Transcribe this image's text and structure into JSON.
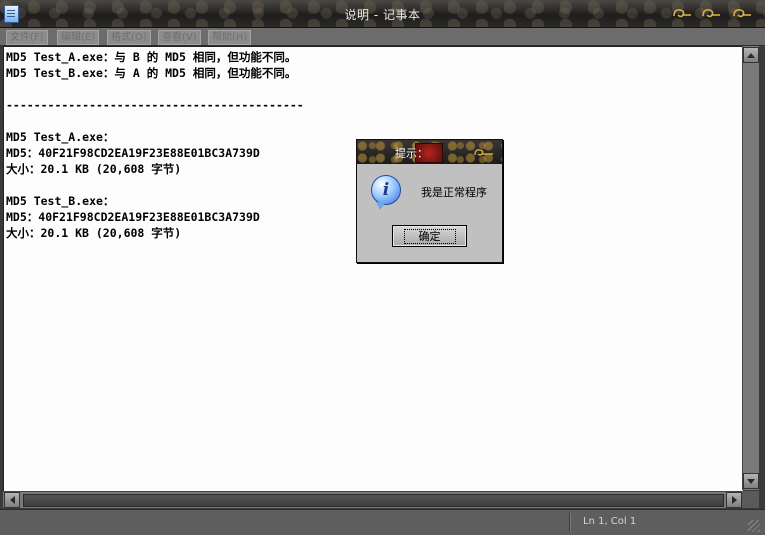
{
  "window": {
    "title": "说明 - 记事本",
    "icon": "notepad-icon",
    "buttons": [
      "minimize-icon",
      "maximize-icon",
      "close-icon"
    ],
    "accent": "#d8b04a"
  },
  "menu": {
    "items": [
      {
        "label": "文件(F)"
      },
      {
        "label": "编辑(E)"
      },
      {
        "label": "格式(O)"
      },
      {
        "label": "查看(V)"
      },
      {
        "label": "帮助(H)"
      }
    ]
  },
  "editor": {
    "lines": [
      "MD5 Test_A.exe：与 B 的 MD5 相同，但功能不同。",
      "MD5 Test_B.exe：与 A 的 MD5 相同，但功能不同。",
      "",
      "-------------------------------------------",
      "",
      "",
      "MD5 Test_A.exe：",
      "MD5：40F21F98CD2EA19F23E88E01BC3A739D",
      "大小：20.1 KB (20,608 字节)",
      "",
      "MD5 Test_B.exe：",
      "MD5：40F21F98CD2EA19F23E88E01BC3A739D",
      "大小：20.1 KB (20,608 字节)"
    ]
  },
  "status": {
    "position": "Ln 1, Col 1"
  },
  "dialog": {
    "title": "提示：",
    "icon": "info-icon",
    "message": "我是正常程序",
    "ok_label": "确定"
  }
}
